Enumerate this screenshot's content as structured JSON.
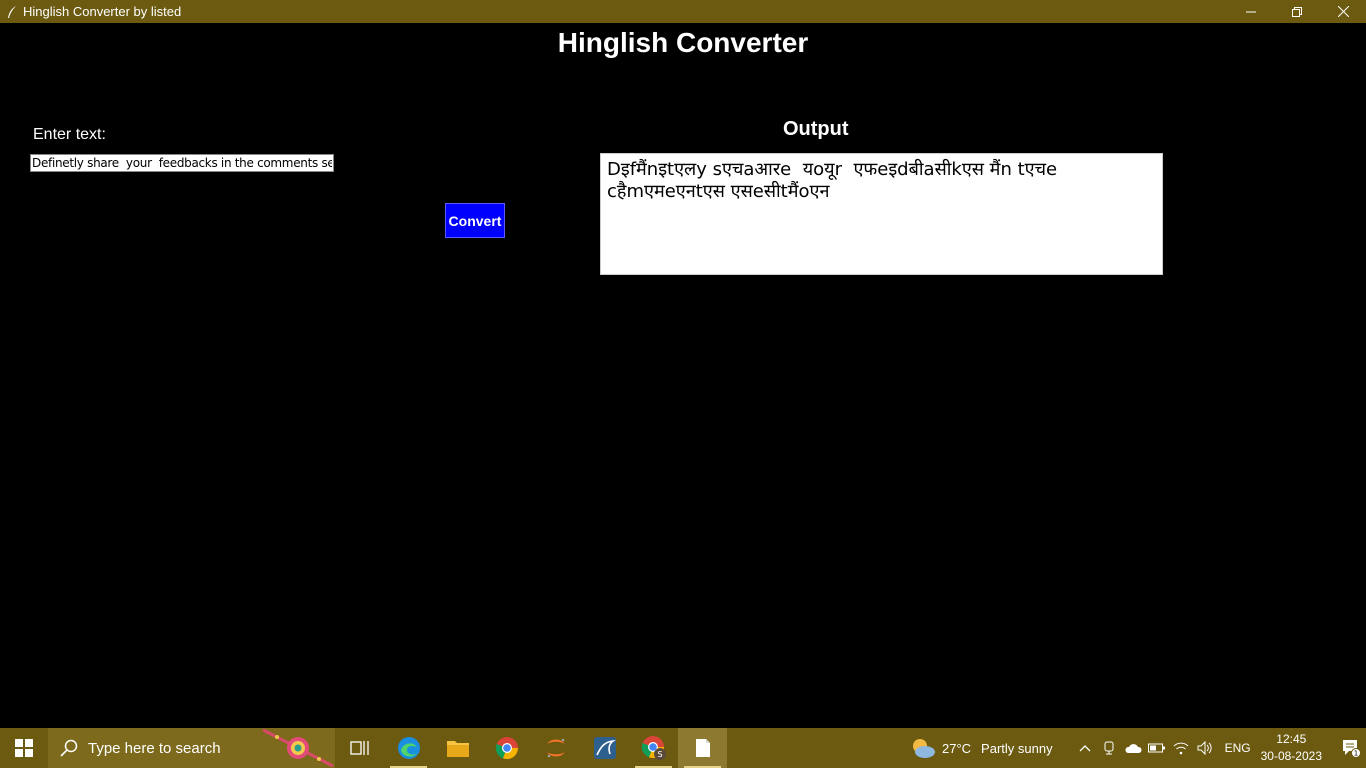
{
  "window": {
    "title": "Hinglish Converter by listed"
  },
  "app": {
    "heading": "Hinglish Converter",
    "input_label": "Enter text:",
    "input_value": "Definetly share  your  feedbacks in the comments section",
    "convert_label": "Convert",
    "output_label": "Output",
    "output_text": "Dइfमैंnइtएलy sएचaआरe  यoयूr  एफeइdबीaसीkएस मैंn tएचe\ncहैmएमeएनtएस एसeसीtमैंoएन"
  },
  "taskbar": {
    "search_placeholder": "Type here to search",
    "weather_temp": "27°C",
    "weather_desc": "Partly sunny",
    "language": "ENG",
    "time": "12:45",
    "date": "30-08-2023",
    "notification_count": "1"
  },
  "colors": {
    "titlebar": "#6b5a10",
    "background": "#000000",
    "convert_button": "#0000ff"
  }
}
